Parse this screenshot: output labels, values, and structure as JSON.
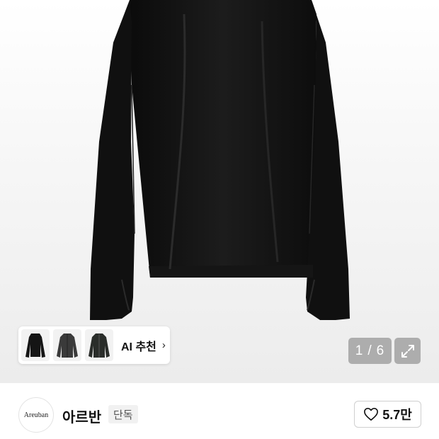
{
  "gallery": {
    "counter_current": "1",
    "counter_separator": "/",
    "counter_total": "6",
    "expand_icon": "expand-icon"
  },
  "ai_recommend": {
    "label": "AI 추천",
    "chevron": "›",
    "thumbnails": [
      "black-top-thumbnail",
      "charcoal-jacket-thumbnail",
      "dark-zip-jacket-thumbnail"
    ]
  },
  "brand": {
    "logo_text": "Areuban",
    "name": "아르반",
    "badge": "단독"
  },
  "like": {
    "icon": "heart-icon",
    "count": "5.7만"
  }
}
